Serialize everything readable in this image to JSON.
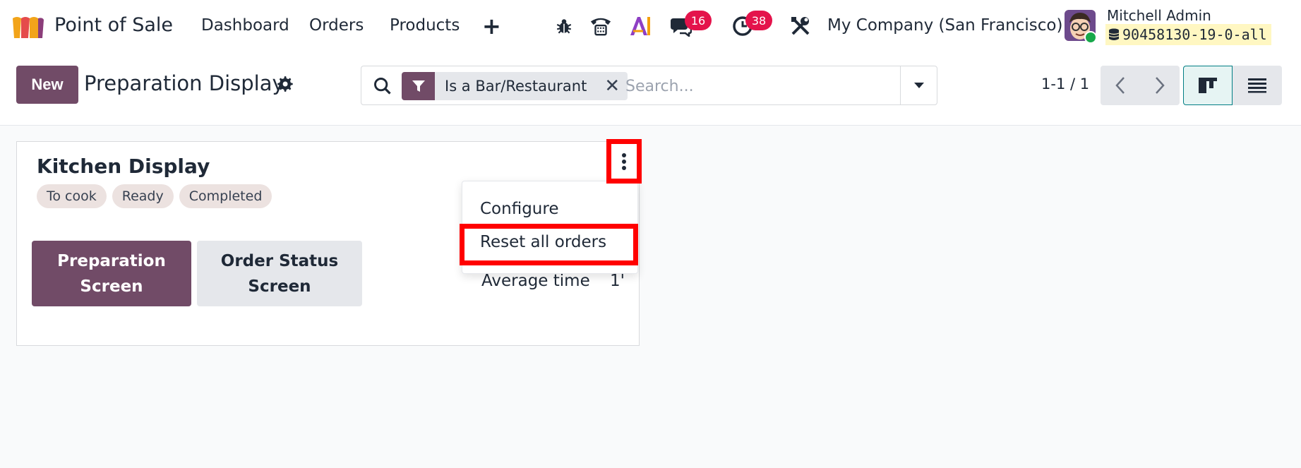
{
  "navbar": {
    "app_name": "Point of Sale",
    "menu": [
      "Dashboard",
      "Orders",
      "Products"
    ],
    "messages_badge": "16",
    "activities_badge": "38",
    "company": "My Company (San Francisco)",
    "user_name": "Mitchell Admin",
    "database": "90458130-19-0-all"
  },
  "control_panel": {
    "new_label": "New",
    "title": "Preparation Display",
    "facet_label": "Is a Bar/Restaurant",
    "search_placeholder": "Search...",
    "pager": "1-1 / 1"
  },
  "card": {
    "title": "Kitchen Display",
    "tags": [
      "To cook",
      "Ready",
      "Completed"
    ],
    "prep_button": "Preparation Screen",
    "status_button": "Order Status Screen",
    "avg_label": "Average time",
    "avg_value": "1'"
  },
  "dropdown": {
    "items": [
      "Configure",
      "Reset all orders"
    ]
  },
  "colors": {
    "brand": "#714b67",
    "badge": "#e4134b",
    "highlight": "#ff0000"
  }
}
